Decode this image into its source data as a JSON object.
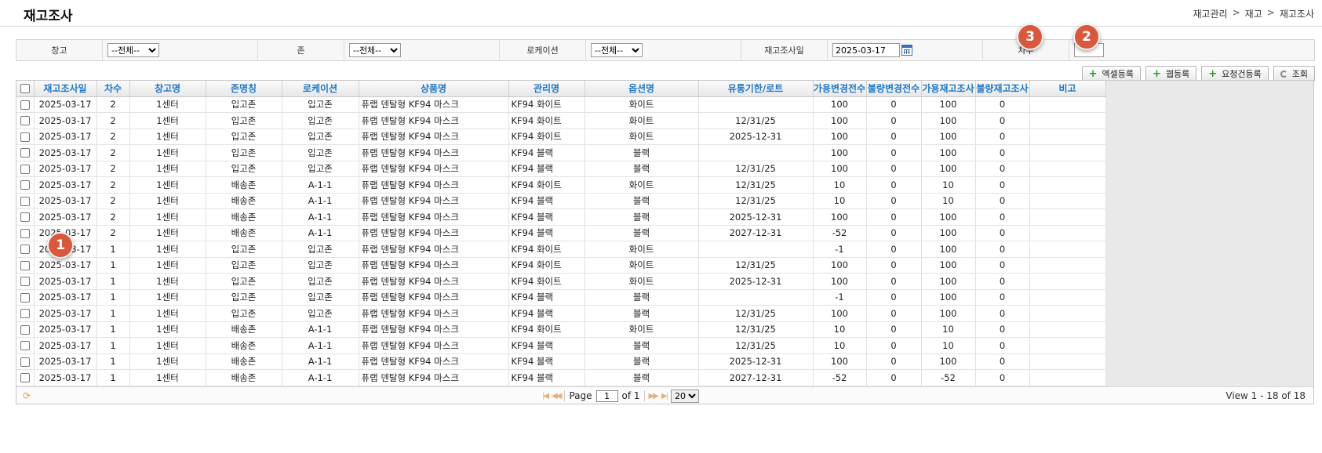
{
  "page": {
    "title": "재고조사",
    "breadcrumb": [
      "재고관리",
      "재고",
      "재고조사"
    ],
    "breadcrumb_sep": ">"
  },
  "search": {
    "warehouse_label": "창고",
    "warehouse_value": "--전체--",
    "zone_label": "존",
    "zone_value": "--전체--",
    "location_label": "로케이션",
    "location_value": "--전체--",
    "date_label": "재고조사일",
    "date_value": "2025-03-17",
    "extra_label": "차수",
    "extra_value": ""
  },
  "buttons": {
    "excel": "엑셀등록",
    "web": "웹등록",
    "request": "요청건등록",
    "query": "조회"
  },
  "table": {
    "headers": [
      "재고조사일",
      "차수",
      "창고명",
      "존명칭",
      "로케이션",
      "상품명",
      "관리명",
      "옵션명",
      "유통기한/로트",
      "가용변경전수",
      "불량변경전수",
      "가용재고조사",
      "불량재고조사",
      "비고"
    ],
    "rows": [
      [
        "2025-03-17",
        "2",
        "1센터",
        "입고존",
        "입고존",
        "퓨랩 덴탈형 KF94 마스크",
        "KF94 화이트",
        "화이트",
        "",
        "100",
        "0",
        "100",
        "0",
        ""
      ],
      [
        "2025-03-17",
        "2",
        "1센터",
        "입고존",
        "입고존",
        "퓨랩 덴탈형 KF94 마스크",
        "KF94 화이트",
        "화이트",
        "12/31/25",
        "100",
        "0",
        "100",
        "0",
        ""
      ],
      [
        "2025-03-17",
        "2",
        "1센터",
        "입고존",
        "입고존",
        "퓨랩 덴탈형 KF94 마스크",
        "KF94 화이트",
        "화이트",
        "2025-12-31",
        "100",
        "0",
        "100",
        "0",
        ""
      ],
      [
        "2025-03-17",
        "2",
        "1센터",
        "입고존",
        "입고존",
        "퓨랩 덴탈형 KF94 마스크",
        "KF94 블랙",
        "블랙",
        "",
        "100",
        "0",
        "100",
        "0",
        ""
      ],
      [
        "2025-03-17",
        "2",
        "1센터",
        "입고존",
        "입고존",
        "퓨랩 덴탈형 KF94 마스크",
        "KF94 블랙",
        "블랙",
        "12/31/25",
        "100",
        "0",
        "100",
        "0",
        ""
      ],
      [
        "2025-03-17",
        "2",
        "1센터",
        "배송존",
        "A-1-1",
        "퓨랩 덴탈형 KF94 마스크",
        "KF94 화이트",
        "화이트",
        "12/31/25",
        "10",
        "0",
        "10",
        "0",
        ""
      ],
      [
        "2025-03-17",
        "2",
        "1센터",
        "배송존",
        "A-1-1",
        "퓨랩 덴탈형 KF94 마스크",
        "KF94 블랙",
        "블랙",
        "12/31/25",
        "10",
        "0",
        "10",
        "0",
        ""
      ],
      [
        "2025-03-17",
        "2",
        "1센터",
        "배송존",
        "A-1-1",
        "퓨랩 덴탈형 KF94 마스크",
        "KF94 블랙",
        "블랙",
        "2025-12-31",
        "100",
        "0",
        "100",
        "0",
        ""
      ],
      [
        "2025-03-17",
        "2",
        "1센터",
        "배송존",
        "A-1-1",
        "퓨랩 덴탈형 KF94 마스크",
        "KF94 블랙",
        "블랙",
        "2027-12-31",
        "-52",
        "0",
        "100",
        "0",
        ""
      ],
      [
        "2025-03-17",
        "1",
        "1센터",
        "입고존",
        "입고존",
        "퓨랩 덴탈형 KF94 마스크",
        "KF94 화이트",
        "화이트",
        "",
        "-1",
        "0",
        "100",
        "0",
        ""
      ],
      [
        "2025-03-17",
        "1",
        "1센터",
        "입고존",
        "입고존",
        "퓨랩 덴탈형 KF94 마스크",
        "KF94 화이트",
        "화이트",
        "12/31/25",
        "100",
        "0",
        "100",
        "0",
        ""
      ],
      [
        "2025-03-17",
        "1",
        "1센터",
        "입고존",
        "입고존",
        "퓨랩 덴탈형 KF94 마스크",
        "KF94 화이트",
        "화이트",
        "2025-12-31",
        "100",
        "0",
        "100",
        "0",
        ""
      ],
      [
        "2025-03-17",
        "1",
        "1센터",
        "입고존",
        "입고존",
        "퓨랩 덴탈형 KF94 마스크",
        "KF94 블랙",
        "블랙",
        "",
        "-1",
        "0",
        "100",
        "0",
        ""
      ],
      [
        "2025-03-17",
        "1",
        "1센터",
        "입고존",
        "입고존",
        "퓨랩 덴탈형 KF94 마스크",
        "KF94 블랙",
        "블랙",
        "12/31/25",
        "100",
        "0",
        "100",
        "0",
        ""
      ],
      [
        "2025-03-17",
        "1",
        "1센터",
        "배송존",
        "A-1-1",
        "퓨랩 덴탈형 KF94 마스크",
        "KF94 화이트",
        "화이트",
        "12/31/25",
        "10",
        "0",
        "10",
        "0",
        ""
      ],
      [
        "2025-03-17",
        "1",
        "1센터",
        "배송존",
        "A-1-1",
        "퓨랩 덴탈형 KF94 마스크",
        "KF94 블랙",
        "블랙",
        "12/31/25",
        "10",
        "0",
        "10",
        "0",
        ""
      ],
      [
        "2025-03-17",
        "1",
        "1센터",
        "배송존",
        "A-1-1",
        "퓨랩 덴탈형 KF94 마스크",
        "KF94 블랙",
        "블랙",
        "2025-12-31",
        "100",
        "0",
        "100",
        "0",
        ""
      ],
      [
        "2025-03-17",
        "1",
        "1센터",
        "배송존",
        "A-1-1",
        "퓨랩 덴탈형 KF94 마스크",
        "KF94 블랙",
        "블랙",
        "2027-12-31",
        "-52",
        "0",
        "-52",
        "0",
        ""
      ]
    ]
  },
  "pager": {
    "page_label": "Page",
    "page_value": "1",
    "of_label": "of 1",
    "page_size": "20",
    "view_info": "View 1 - 18 of 18"
  },
  "badges": [
    "1",
    "2",
    "3"
  ],
  "colors": {
    "header_text": "#1f78c7",
    "badge": "#d9573b",
    "plus_icon": "#2b9a2b"
  }
}
